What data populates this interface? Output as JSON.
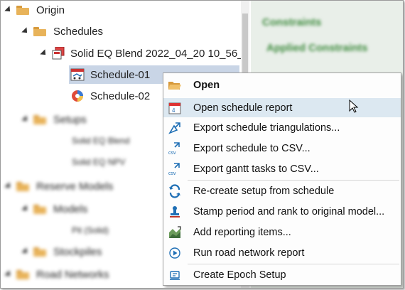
{
  "tree": {
    "origin": "Origin",
    "schedules": "Schedules",
    "blend": "Solid EQ Blend 2022_04_20 10_56_5",
    "schedule1": "Schedule-01",
    "schedule2": "Schedule-02",
    "blurred": [
      "Setups",
      "Solid EQ Blend",
      "Solid EQ NPV",
      "Reserve Models",
      "Models",
      "Pit (Solid)",
      "Stockpiles",
      "Road Networks"
    ]
  },
  "right_pane": {
    "items": [
      "Constraints",
      "Applied Constraints"
    ]
  },
  "menu": {
    "items": [
      {
        "label": "Open",
        "icon": "folder-open-icon",
        "bold": true
      },
      {
        "label": "Open schedule report",
        "icon": "calendar-report-icon",
        "highlighted": true
      },
      {
        "label": "Export schedule triangulations...",
        "icon": "export-triangulation-icon"
      },
      {
        "label": "Export schedule to CSV...",
        "icon": "export-csv-icon"
      },
      {
        "label": "Export gantt tasks to CSV...",
        "icon": "export-csv-icon"
      },
      {
        "label": "Re-create setup from schedule",
        "icon": "refresh-icon"
      },
      {
        "label": "Stamp period and rank to original model...",
        "icon": "stamp-icon"
      },
      {
        "label": "Add reporting items...",
        "icon": "reporting-items-icon"
      },
      {
        "label": "Run road network report",
        "icon": "play-icon"
      },
      {
        "label": "Create Epoch Setup",
        "icon": "epoch-setup-icon"
      }
    ]
  },
  "colors": {
    "selection": "#c9d5e6",
    "hover": "#dce8f1",
    "folder": "#e8b35a",
    "accent": "#1f6fb5"
  }
}
